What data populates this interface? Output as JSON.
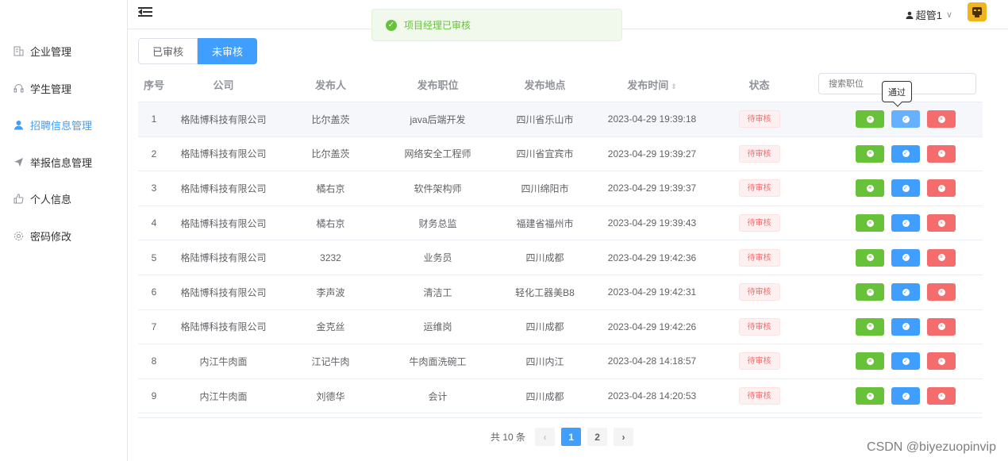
{
  "sidebar": {
    "items": [
      {
        "label": "企业管理",
        "icon": "building-icon"
      },
      {
        "label": "学生管理",
        "icon": "headset-icon"
      },
      {
        "label": "招聘信息管理",
        "icon": "user-icon"
      },
      {
        "label": "举报信息管理",
        "icon": "send-icon"
      },
      {
        "label": "个人信息",
        "icon": "thumb-icon"
      },
      {
        "label": "密码修改",
        "icon": "gear-icon"
      }
    ]
  },
  "header": {
    "user_name": "超管1",
    "user_caret": "∨"
  },
  "toast": {
    "message": "项目经理已审核"
  },
  "tabs": [
    {
      "label": "已审核"
    },
    {
      "label": "未审核"
    }
  ],
  "search": {
    "placeholder": "搜索职位"
  },
  "tooltip": {
    "text": "通过"
  },
  "table": {
    "headers": [
      "序号",
      "公司",
      "发布人",
      "发布职位",
      "发布地点",
      "发布时间",
      "状态"
    ],
    "rows": [
      [
        "1",
        "格陆博科技有限公司",
        "比尔盖茨",
        "java后端开发",
        "四川省乐山市",
        "2023-04-29 19:39:18",
        "待审核"
      ],
      [
        "2",
        "格陆博科技有限公司",
        "比尔盖茨",
        "网络安全工程师",
        "四川省宜宾市",
        "2023-04-29 19:39:27",
        "待审核"
      ],
      [
        "3",
        "格陆博科技有限公司",
        "橘右京",
        "软件架构师",
        "四川绵阳市",
        "2023-04-29 19:39:37",
        "待审核"
      ],
      [
        "4",
        "格陆博科技有限公司",
        "橘右京",
        "财务总监",
        "福建省福州市",
        "2023-04-29 19:39:43",
        "待审核"
      ],
      [
        "5",
        "格陆博科技有限公司",
        "3232",
        "业务员",
        "四川成都",
        "2023-04-29 19:42:36",
        "待审核"
      ],
      [
        "6",
        "格陆博科技有限公司",
        "李声波",
        "清洁工",
        "轻化工器美B8",
        "2023-04-29 19:42:31",
        "待审核"
      ],
      [
        "7",
        "格陆博科技有限公司",
        "金克丝",
        "运维岗",
        "四川成都",
        "2023-04-29 19:42:26",
        "待审核"
      ],
      [
        "8",
        "内江牛肉面",
        "江记牛肉",
        "牛肉面洗碗工",
        "四川内江",
        "2023-04-28 14:18:57",
        "待审核"
      ],
      [
        "9",
        "内江牛肉面",
        "刘德华",
        "会计",
        "四川成都",
        "2023-04-28 14:20:53",
        "待审核"
      ]
    ]
  },
  "pagination": {
    "total": "共 10 条",
    "pages": [
      "1",
      "2"
    ],
    "prev": "‹",
    "next": "›"
  },
  "watermark": "CSDN @biyezuopinvip",
  "colors": {
    "accent": "#409eff",
    "success": "#67c23a",
    "danger": "#f56c6c"
  }
}
